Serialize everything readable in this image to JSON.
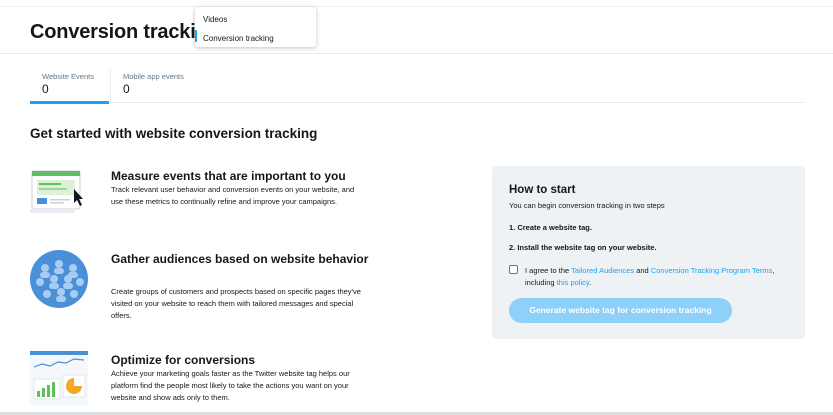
{
  "header": {
    "title": "Conversion tracking"
  },
  "dropdown": {
    "items": [
      {
        "label": "Videos"
      },
      {
        "label": "Conversion tracking"
      }
    ]
  },
  "tabs": [
    {
      "label": "Website Events",
      "count": "0",
      "active": true
    },
    {
      "label": "Mobile app events",
      "count": "0",
      "active": false
    }
  ],
  "section": {
    "heading": "Get started with website conversion tracking"
  },
  "features": [
    {
      "icon": "conversion-events-illustration",
      "title": "Measure events that are important to you",
      "text": "Track relevant user behavior and conversion events on your website, and use these metrics to continually refine and improve your campaigns."
    },
    {
      "icon": "audience-globe-illustration",
      "title": "Gather audiences based on website behavior",
      "text": "Create groups of customers and prospects based on specific pages they've visited on your website to reach them with tailored messages and special offers."
    },
    {
      "icon": "optimization-charts-illustration",
      "title": "Optimize for conversions",
      "text": "Achieve your marketing goals faster as the Twitter website tag helps our platform find the people most likely to take the actions you want on your website and show ads only to them."
    }
  ],
  "howto": {
    "title": "How to start",
    "subtitle": "You can begin conversion tracking in two steps",
    "steps": [
      "1. Create a website tag.",
      "2. Install the website tag on your website."
    ],
    "agree": {
      "prefix": "I agree to the ",
      "link1": "Tailored Audiences",
      "middle": " and ",
      "link2": "Conversion Tracking Program Terms",
      "comma": ", including ",
      "link3": "this policy",
      "suffix": "."
    },
    "button_label": "Generate website tag for conversion tracking"
  },
  "colors": {
    "accent": "#1da1f2",
    "button_disabled": "#8ed0f9",
    "panel_bg": "#eef2f5",
    "green": "#5fbf5f",
    "blue": "#4a90d9",
    "orange": "#f5a623"
  }
}
